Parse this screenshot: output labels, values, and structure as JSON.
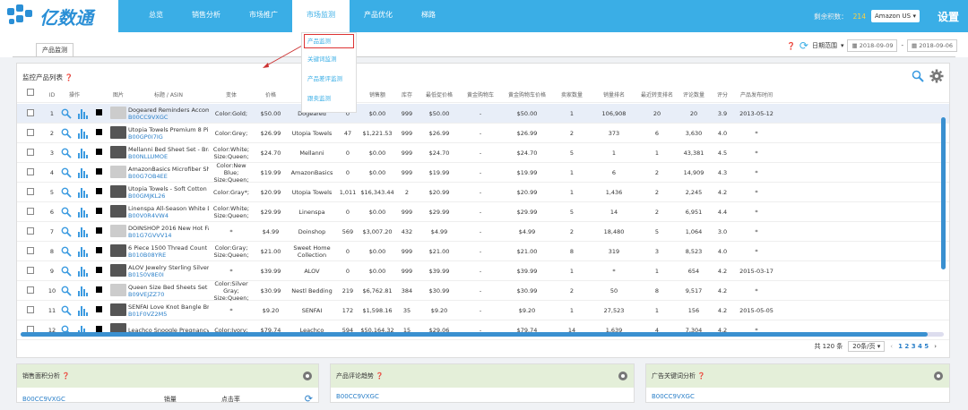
{
  "app": {
    "logo_text": "亿数通"
  },
  "nav": [
    {
      "label": "总览"
    },
    {
      "label": "销售分析"
    },
    {
      "label": "市场推广"
    },
    {
      "label": "市场监测",
      "active": true
    },
    {
      "label": "产品优化"
    },
    {
      "label": "梯路"
    }
  ],
  "topright": {
    "account_label": "剩余积数：",
    "account_value": "214",
    "marketplace": "Amazon US",
    "settings": "设置"
  },
  "dropdown": [
    {
      "label": "产品监测",
      "highlighted": true
    },
    {
      "label": "关键词监测"
    },
    {
      "label": "产品差评监测"
    },
    {
      "label": "跟卖监测"
    }
  ],
  "tab": {
    "label": "产品监测"
  },
  "dates": {
    "range_label": "日期范围",
    "start": "2018-09-09",
    "end": "2018-09-06"
  },
  "panel": {
    "title": "监控产品列表"
  },
  "columns": [
    "ID",
    "操作",
    "",
    "图片",
    "标题 / ASIN",
    "变体",
    "价格",
    "卖家",
    "销量",
    "销售额",
    "库存",
    "最低促价格",
    "黄金购物车",
    "黄金购物车价格",
    "卖家数量",
    "销量排名",
    "最近转变排名",
    "评论数量",
    "评分",
    "产品发布时间"
  ],
  "rows": [
    {
      "id": "1",
      "title": "Dogeared Reminders Accom...",
      "asin": "B00CC9VXGC",
      "variant": "Color:Gold;",
      "price": "$50.00",
      "seller": "Dogeared",
      "sales": "0",
      "revenue": "$0.00",
      "stock": "999",
      "low_price": "$50.00",
      "buybox": "-",
      "buybox_price": "$50.00",
      "sellers": "1",
      "rank": "106,908",
      "recent_rank": "20",
      "reviews": "20",
      "rating": "3.9",
      "release": "2013-05-12",
      "selected": true
    },
    {
      "id": "2",
      "title": "Utopia Towels Premium 8 Pi...",
      "asin": "B00GP0I7IG",
      "variant": "Color:Grey;",
      "price": "$26.99",
      "seller": "Utopia Towels",
      "sales": "47",
      "revenue": "$1,221.53",
      "stock": "999",
      "low_price": "$26.99",
      "buybox": "-",
      "buybox_price": "$26.99",
      "sellers": "2",
      "rank": "373",
      "recent_rank": "6",
      "reviews": "3,630",
      "rating": "4.0",
      "release": "*"
    },
    {
      "id": "3",
      "title": "Mellanni Bed Sheet Set - Bra...",
      "asin": "B00NLLUMOE",
      "variant": "Color:White; Size:Queen;",
      "price": "$24.70",
      "seller": "Mellanni",
      "sales": "0",
      "revenue": "$0.00",
      "stock": "999",
      "low_price": "$24.70",
      "buybox": "-",
      "buybox_price": "$24.70",
      "sellers": "5",
      "rank": "1",
      "recent_rank": "1",
      "reviews": "43,381",
      "rating": "4.5",
      "release": "*"
    },
    {
      "id": "4",
      "title": "AmazonBasics Microfiber Sh...",
      "asin": "B00G7OB4EE",
      "variant": "Color:New Blue; Size:Queen;",
      "price": "$19.99",
      "seller": "AmazonBasics",
      "sales": "0",
      "revenue": "$0.00",
      "stock": "999",
      "low_price": "$19.99",
      "buybox": "-",
      "buybox_price": "$19.99",
      "sellers": "1",
      "rank": "6",
      "recent_rank": "2",
      "reviews": "14,909",
      "rating": "4.3",
      "release": "*"
    },
    {
      "id": "5",
      "title": "Utopia Towels - Soft Cotton M...",
      "asin": "B00GMJKL26",
      "variant": "Color:Gray*;",
      "price": "$20.99",
      "seller": "Utopia Towels",
      "sales": "1,011",
      "revenue": "$16,343.44",
      "stock": "2",
      "low_price": "$20.99",
      "buybox": "-",
      "buybox_price": "$20.99",
      "sellers": "1",
      "rank": "1,436",
      "recent_rank": "2",
      "reviews": "2,245",
      "rating": "4.2",
      "release": "*"
    },
    {
      "id": "6",
      "title": "Linenspa All-Season White D...",
      "asin": "B00V0R4VW4",
      "variant": "Color:White; Size:Queen;",
      "price": "$29.99",
      "seller": "Linenspa",
      "sales": "0",
      "revenue": "$0.00",
      "stock": "999",
      "low_price": "$29.99",
      "buybox": "-",
      "buybox_price": "$29.99",
      "sellers": "5",
      "rank": "14",
      "recent_rank": "2",
      "reviews": "6,951",
      "rating": "4.4",
      "release": "*"
    },
    {
      "id": "7",
      "title": "DOINSHOP 2016 New Hot Fa...",
      "asin": "B01G7GVVV14",
      "variant": "*",
      "price": "$4.99",
      "seller": "Doinshop",
      "sales": "569",
      "revenue": "$3,007.20",
      "stock": "432",
      "low_price": "$4.99",
      "buybox": "-",
      "buybox_price": "$4.99",
      "sellers": "2",
      "rank": "18,480",
      "recent_rank": "5",
      "reviews": "1,064",
      "rating": "3.0",
      "release": "*"
    },
    {
      "id": "8",
      "title": "6 Piece 1500 Thread Count D...",
      "asin": "B010B08YRE",
      "variant": "Color:Gray; Size:Queen;",
      "price": "$21.00",
      "seller": "Sweet Home Collection",
      "sales": "0",
      "revenue": "$0.00",
      "stock": "999",
      "low_price": "$21.00",
      "buybox": "-",
      "buybox_price": "$21.00",
      "sellers": "8",
      "rank": "319",
      "recent_rank": "3",
      "reviews": "8,523",
      "rating": "4.0",
      "release": "*"
    },
    {
      "id": "9",
      "title": "ALOV Jewelry Sterling Silver I...",
      "asin": "B0150V8E0I",
      "variant": "*",
      "price": "$39.99",
      "seller": "ALOV",
      "sales": "0",
      "revenue": "$0.00",
      "stock": "999",
      "low_price": "$39.99",
      "buybox": "-",
      "buybox_price": "$39.99",
      "sellers": "1",
      "rank": "*",
      "recent_rank": "1",
      "reviews": "654",
      "rating": "4.2",
      "release": "2015-03-17"
    },
    {
      "id": "10",
      "title": "Queen Size Bed Sheets Set S...",
      "asin": "B09VEJZZ70",
      "variant": "Color:Silver Gray; Size:Queen;",
      "price": "$30.99",
      "seller": "Nestl Bedding",
      "sales": "219",
      "revenue": "$6,762.81",
      "stock": "384",
      "low_price": "$30.99",
      "buybox": "-",
      "buybox_price": "$30.99",
      "sellers": "2",
      "rank": "50",
      "recent_rank": "8",
      "reviews": "9,517",
      "rating": "4.2",
      "release": "*"
    },
    {
      "id": "11",
      "title": "SENFAI Love Knot Bangle Bra...",
      "asin": "B01F0VZ2M5",
      "variant": "*",
      "price": "$9.20",
      "seller": "SENFAI",
      "sales": "172",
      "revenue": "$1,598.16",
      "stock": "35",
      "low_price": "$9.20",
      "buybox": "-",
      "buybox_price": "$9.20",
      "sellers": "1",
      "rank": "27,523",
      "recent_rank": "1",
      "reviews": "156",
      "rating": "4.2",
      "release": "2015-05-05"
    },
    {
      "id": "12",
      "title": "Leachco Snoogle Pregnancy/...",
      "asin": "",
      "variant": "Color:Ivory;",
      "price": "$79.74",
      "seller": "Leachco",
      "sales": "594",
      "revenue": "$50,164.32",
      "stock": "15",
      "low_price": "$29.06",
      "buybox": "-",
      "buybox_price": "$79.74",
      "sellers": "14",
      "rank": "1,639",
      "recent_rank": "4",
      "reviews": "7,304",
      "rating": "4.2",
      "release": "*"
    }
  ],
  "pager": {
    "total": "共 120 条",
    "page_size": "20条/页",
    "pages": "1 2 3 4 5"
  },
  "bottom": [
    {
      "title": "销售面积分析",
      "asin": "B00CC9VXGC",
      "metric": "销量",
      "compare": "点击率"
    },
    {
      "title": "产品评论趋势",
      "asin": "B00CC9VXGC"
    },
    {
      "title": "广告关键词分析",
      "asin": "B00CC9VXGC"
    }
  ],
  "colors": {
    "primary": "#3aaee6",
    "link": "#2a7fc8",
    "chart_bar": "#3a9ae0"
  }
}
